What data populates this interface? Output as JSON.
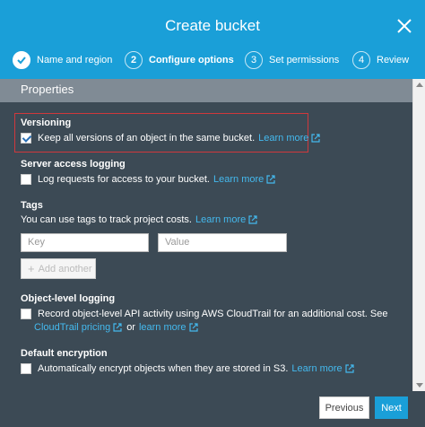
{
  "dialog": {
    "title": "Create bucket"
  },
  "steps": [
    {
      "number": "✓",
      "label": "Name and region",
      "state": "done"
    },
    {
      "number": "2",
      "label": "Configure options",
      "state": "active"
    },
    {
      "number": "3",
      "label": "Set permissions",
      "state": "pending"
    },
    {
      "number": "4",
      "label": "Review",
      "state": "pending"
    }
  ],
  "properties": {
    "header": "Properties"
  },
  "versioning": {
    "title": "Versioning",
    "checkbox_label": "Keep all versions of an object in the same bucket.",
    "checked": true,
    "link": "Learn more"
  },
  "server_logging": {
    "title": "Server access logging",
    "checkbox_label": "Log requests for access to your bucket.",
    "checked": false,
    "link": "Learn more"
  },
  "tags": {
    "title": "Tags",
    "description": "You can use tags to track project costs.",
    "link": "Learn more",
    "key_placeholder": "Key",
    "value_placeholder": "Value",
    "add_label": "Add another"
  },
  "object_logging": {
    "title": "Object-level logging",
    "checkbox_label": "Record object-level API activity using AWS CloudTrail for an additional cost. See",
    "checked": false,
    "pricing_link": "CloudTrail pricing",
    "or_text": "or",
    "link": "learn more"
  },
  "encryption": {
    "title": "Default encryption",
    "checkbox_label": "Automatically encrypt objects when they are stored in S3.",
    "checked": false,
    "link": "Learn more"
  },
  "footer": {
    "previous_label": "Previous",
    "next_label": "Next"
  },
  "colors": {
    "header_bg": "#1a9fd8",
    "body_bg": "#3c4a55",
    "link": "#44b9ee",
    "highlight": "#d0383c"
  }
}
